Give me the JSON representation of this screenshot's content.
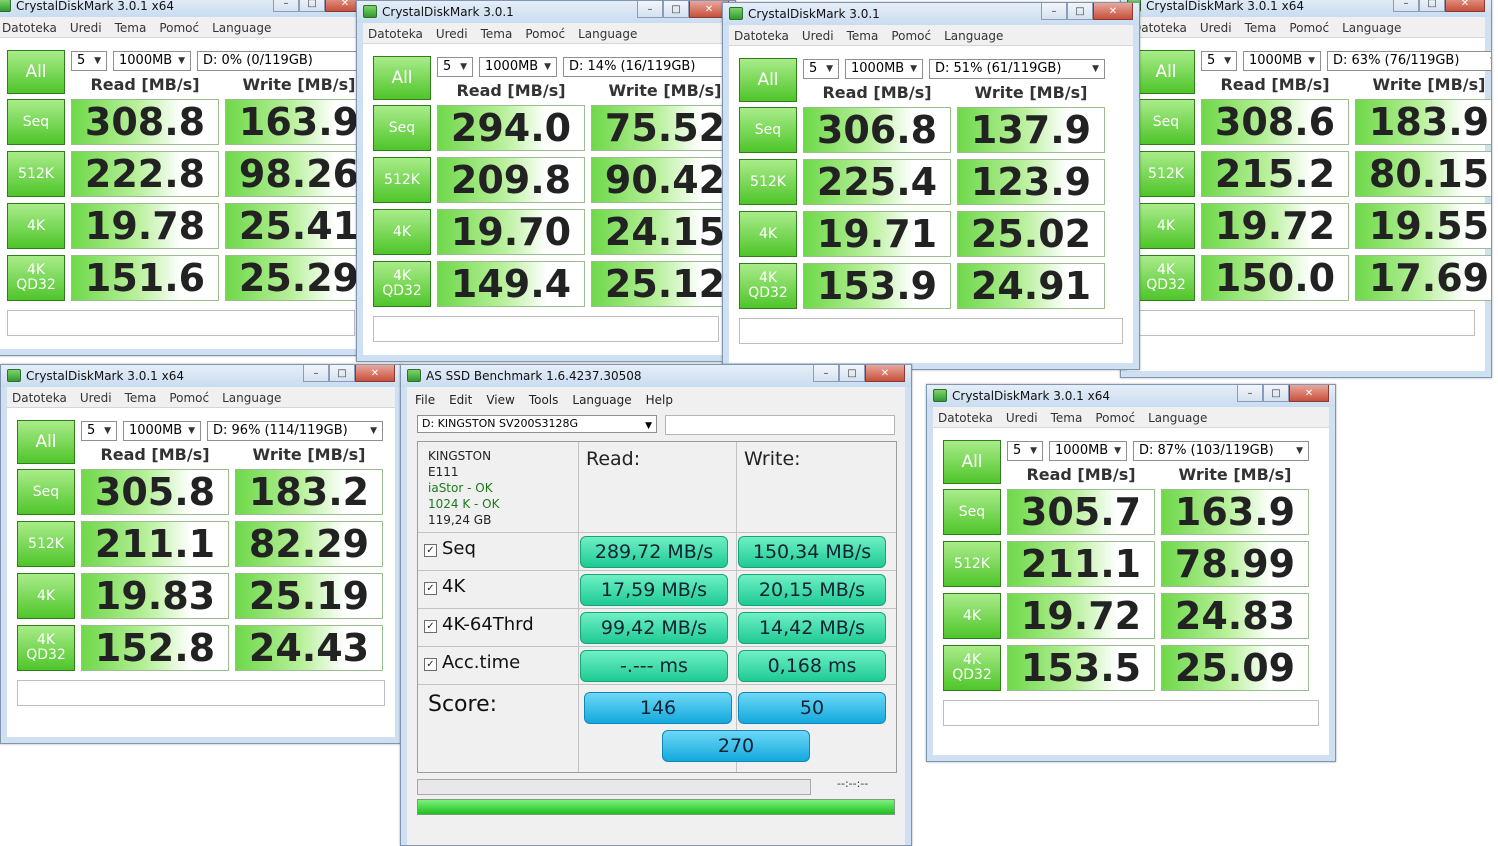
{
  "cdm_labels": {
    "menu": [
      "Datoteka",
      "Uredi",
      "Tema",
      "Pomoć",
      "Language"
    ],
    "all": "All",
    "read": "Read [MB/s]",
    "write": "Write [MB/s]",
    "rows": [
      "Seq",
      "512K",
      "4K",
      "4K QD32"
    ],
    "runs": "5",
    "size": "1000MB"
  },
  "cdm_windows": [
    {
      "title": "CrystalDiskMark 3.0.1 x64",
      "drive": "D: 0% (0/119GB)",
      "read": [
        "308.8",
        "222.8",
        "19.78",
        "151.6"
      ],
      "write": [
        "163.9",
        "98.26",
        "25.41",
        "25.29"
      ]
    },
    {
      "title": "CrystalDiskMark 3.0.1",
      "drive": "D: 14% (16/119GB)",
      "read": [
        "294.0",
        "209.8",
        "19.70",
        "149.4"
      ],
      "write": [
        "75.52",
        "90.42",
        "24.15",
        "25.12"
      ]
    },
    {
      "title": "CrystalDiskMark 3.0.1 x64",
      "drive": "D: 63% (76/119GB)",
      "read": [
        "308.6",
        "215.2",
        "19.72",
        "150.0"
      ],
      "write": [
        "183.9",
        "80.15",
        "19.55",
        "17.69"
      ]
    },
    {
      "title": "CrystalDiskMark 3.0.1",
      "drive": "D: 51% (61/119GB)",
      "read": [
        "306.8",
        "225.4",
        "19.71",
        "153.9"
      ],
      "write": [
        "137.9",
        "123.9",
        "25.02",
        "24.91"
      ]
    },
    {
      "title": "CrystalDiskMark 3.0.1 x64",
      "drive": "D: 96% (114/119GB)",
      "read": [
        "305.8",
        "211.1",
        "19.83",
        "152.8"
      ],
      "write": [
        "183.2",
        "82.29",
        "25.19",
        "24.43"
      ]
    },
    {
      "title": "CrystalDiskMark 3.0.1 x64",
      "drive": "D: 87% (103/119GB)",
      "read": [
        "305.7",
        "211.1",
        "19.72",
        "153.5"
      ],
      "write": [
        "163.9",
        "78.99",
        "24.83",
        "25.09"
      ]
    }
  ],
  "asssd": {
    "title": "AS SSD Benchmark 1.6.4237.30508",
    "menu": [
      "File",
      "Edit",
      "View",
      "Tools",
      "Language",
      "Help"
    ],
    "drive_select": "D: KINGSTON SV200S3128G",
    "info": {
      "model": "KINGSTON",
      "firmware": "E111",
      "driver": "iaStor - OK",
      "align": "1024 K - OK",
      "capacity": "119,24 GB"
    },
    "read_label": "Read:",
    "write_label": "Write:",
    "tests": [
      {
        "name": "Seq",
        "read": "289,72 MB/s",
        "write": "150,34 MB/s"
      },
      {
        "name": "4K",
        "read": "17,59 MB/s",
        "write": "20,15 MB/s"
      },
      {
        "name": "4K-64Thrd",
        "read": "99,42 MB/s",
        "write": "14,42 MB/s"
      },
      {
        "name": "Acc.time",
        "read": "-.--- ms",
        "write": "0,168 ms"
      }
    ],
    "score_label": "Score:",
    "score_read": "146",
    "score_write": "50",
    "score_total": "270",
    "time": "--:--:--",
    "check": "✓"
  }
}
